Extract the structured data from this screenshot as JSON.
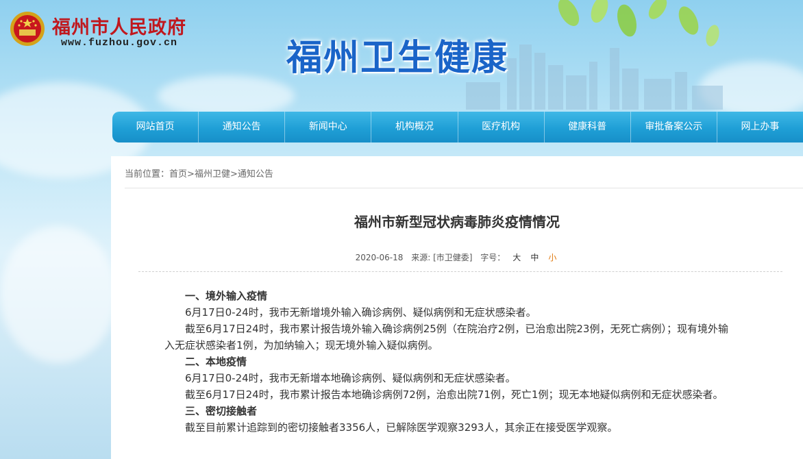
{
  "header": {
    "gov_name": "福州市人民政府",
    "gov_url": "www.fuzhou.gov.cn",
    "site_title": "福州卫生健康"
  },
  "nav": {
    "items": [
      "网站首页",
      "通知公告",
      "新闻中心",
      "机构概况",
      "医疗机构",
      "健康科普",
      "审批备案公示",
      "网上办事"
    ]
  },
  "breadcrumb": {
    "prefix": "当前位置：",
    "items": [
      "首页",
      "福州卫健",
      "通知公告"
    ],
    "separator": ">"
  },
  "article": {
    "title": "福州市新型冠状病毒肺炎疫情情况",
    "date": "2020-06-18",
    "source": "来源: [市卫健委]",
    "font_size_label": "字号：",
    "font_sizes": [
      "大",
      "中",
      "小"
    ],
    "active_font_size": "小",
    "sections": [
      {
        "heading": "一、境外输入疫情",
        "paras": [
          "6月17日0-24时，我市无新增境外输入确诊病例、疑似病例和无症状感染者。",
          "截至6月17日24时，我市累计报告境外输入确诊病例25例（在院治疗2例，已治愈出院23例，无死亡病例）；现有境外输",
          "入无症状感染者1例，为加纳输入；现无境外输入疑似病例。"
        ]
      },
      {
        "heading": "二、本地疫情",
        "paras": [
          "6月17日0-24时，我市无新增本地确诊病例、疑似病例和无症状感染者。",
          "截至6月17日24时，我市累计报告本地确诊病例72例，治愈出院71例，死亡1例；现无本地疑似病例和无症状感染者。"
        ]
      },
      {
        "heading": "三、密切接触者",
        "paras": [
          "截至目前累计追踪到的密切接触者3356人，已解除医学观察3293人，其余正在接受医学观察。"
        ]
      }
    ]
  },
  "colors": {
    "gov_red": "#c0181e",
    "title_blue": "#1a64c8",
    "nav_blue": "#1f9fd6",
    "active_font": "#e07a10"
  }
}
